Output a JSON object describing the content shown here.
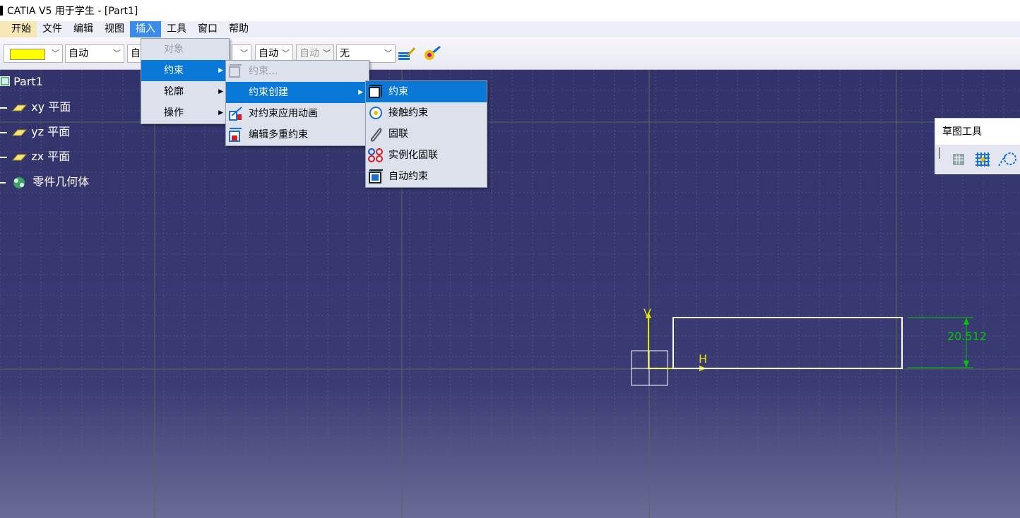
{
  "window": {
    "title": "CATIA V5 用于学生 - [Part1]"
  },
  "menubar": [
    "开始",
    "文件",
    "编辑",
    "视图",
    "插入",
    "工具",
    "窗口",
    "帮助"
  ],
  "toolbar": {
    "color_swatch": "#ffff00",
    "combo1": "自动",
    "combo2": "自",
    "combo3": "自动",
    "combo4": "自动",
    "combo5": "无"
  },
  "insert_menu": {
    "items": [
      {
        "label": "对象",
        "disabled": true
      },
      {
        "label": "约束",
        "highlighted": true,
        "submenu": true
      },
      {
        "label": "轮廓",
        "submenu": true
      },
      {
        "label": "操作",
        "submenu": true
      }
    ]
  },
  "constraint_menu": {
    "items": [
      {
        "label": "约束...",
        "disabled": true,
        "icon": "constraint-icon"
      },
      {
        "label": "约束创建",
        "highlighted": true,
        "submenu": true
      },
      {
        "label": "对约束应用动画",
        "icon": "animate-constraint-icon"
      },
      {
        "label": "编辑多重约束",
        "icon": "edit-multi-constraint-icon"
      }
    ]
  },
  "creation_menu": {
    "items": [
      {
        "label": "约束",
        "highlighted": true,
        "icon": "constraint-icon"
      },
      {
        "label": "接触约束",
        "icon": "contact-constraint-icon"
      },
      {
        "label": "固联",
        "icon": "fix-together-icon"
      },
      {
        "label": "实例化固联",
        "icon": "instantiate-fix-icon"
      },
      {
        "label": "自动约束",
        "icon": "auto-constraint-icon"
      }
    ]
  },
  "tree": {
    "root": "Part1",
    "nodes": [
      "xy 平面",
      "yz 平面",
      "zx 平面",
      "零件几何体"
    ]
  },
  "sketch_tools": {
    "title": "草图工具"
  },
  "sketch": {
    "dimension": "20.512",
    "h_label": "H",
    "v_label": "V"
  },
  "colors": {
    "viewport": "#33336c",
    "highlight": "#0a78d7",
    "sketch_line": "#ffffff",
    "axis": "#e3e300",
    "dimension": "#00c800"
  }
}
